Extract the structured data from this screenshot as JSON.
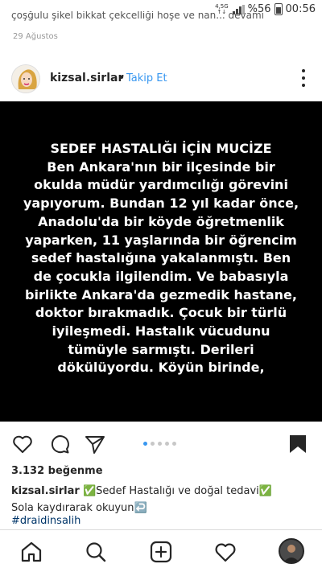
{
  "status_bar": {
    "network_top": "4,5G",
    "network_bottom": "↑↓",
    "battery": "%56",
    "time": "00:56",
    "clipped_text": "çoşğulu şikel bikkat çekcelliği hoşe ve nan... devamı"
  },
  "previous_post": {
    "date": "29 Ağustos"
  },
  "post": {
    "username": "kizsal.sirlar",
    "separator": "•",
    "follow_label": "Takip Et",
    "image_text": "SEDEF HASTALIĞI İÇİN MUCİZE\nBen Ankara'nın bir ilçesinde bir\nokulda müdür yardımcılığı görevini\nyapıyorum. Bundan 12 yıl kadar önce,\nAnadolu'da bir köyde öğretmenlik\nyaparken, 11 yaşlarında bir öğrencim\nsedef hastalığına yakalanmıştı. Ben\nde çocukla ilgilendim. Ve babasıyla\nbirlikte Ankara'da gezmedik hastane,\ndoktor bırakmadık. Çocuk bir türlü\niyileşmedi. Hastalık vücudunu\ntümüyle sarmıştı. Derileri\ndökülüyordu. Köyün birinde,",
    "likes": "3.132 beğenme",
    "caption_user": "kizsal.sirlar",
    "caption_line1": "✅Sedef Hastalığı ve doğal tedavi✅",
    "caption_line2": "Sola kaydırarak okuyun↩️",
    "hashtag": "#draidinsalih",
    "carousel": {
      "count": 5,
      "active": 0
    }
  },
  "icons": {
    "like": "heart-icon",
    "comment": "comment-icon",
    "share": "send-icon",
    "save": "bookmark-icon",
    "home": "home-icon",
    "search": "search-icon",
    "add": "add-post-icon",
    "activity": "heart-icon",
    "profile": "profile-avatar"
  },
  "colors": {
    "link": "#3897f0",
    "hashtag": "#003569",
    "image_bg": "#000000"
  }
}
